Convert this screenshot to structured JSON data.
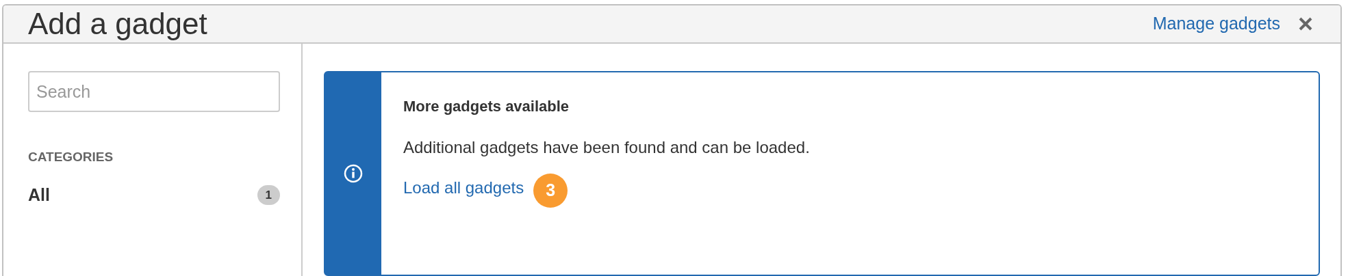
{
  "dialog": {
    "title": "Add a gadget",
    "header_link": "Manage gadgets"
  },
  "sidebar": {
    "search": {
      "placeholder": "Search"
    },
    "heading": "CATEGORIES",
    "categories": [
      {
        "label": "All",
        "count": "1",
        "selected": true
      }
    ]
  },
  "message": {
    "title": "More gadgets available",
    "body": "Additional gadgets have been found and can be loaded.",
    "link": "Load all gadgets",
    "badge": "3"
  }
}
